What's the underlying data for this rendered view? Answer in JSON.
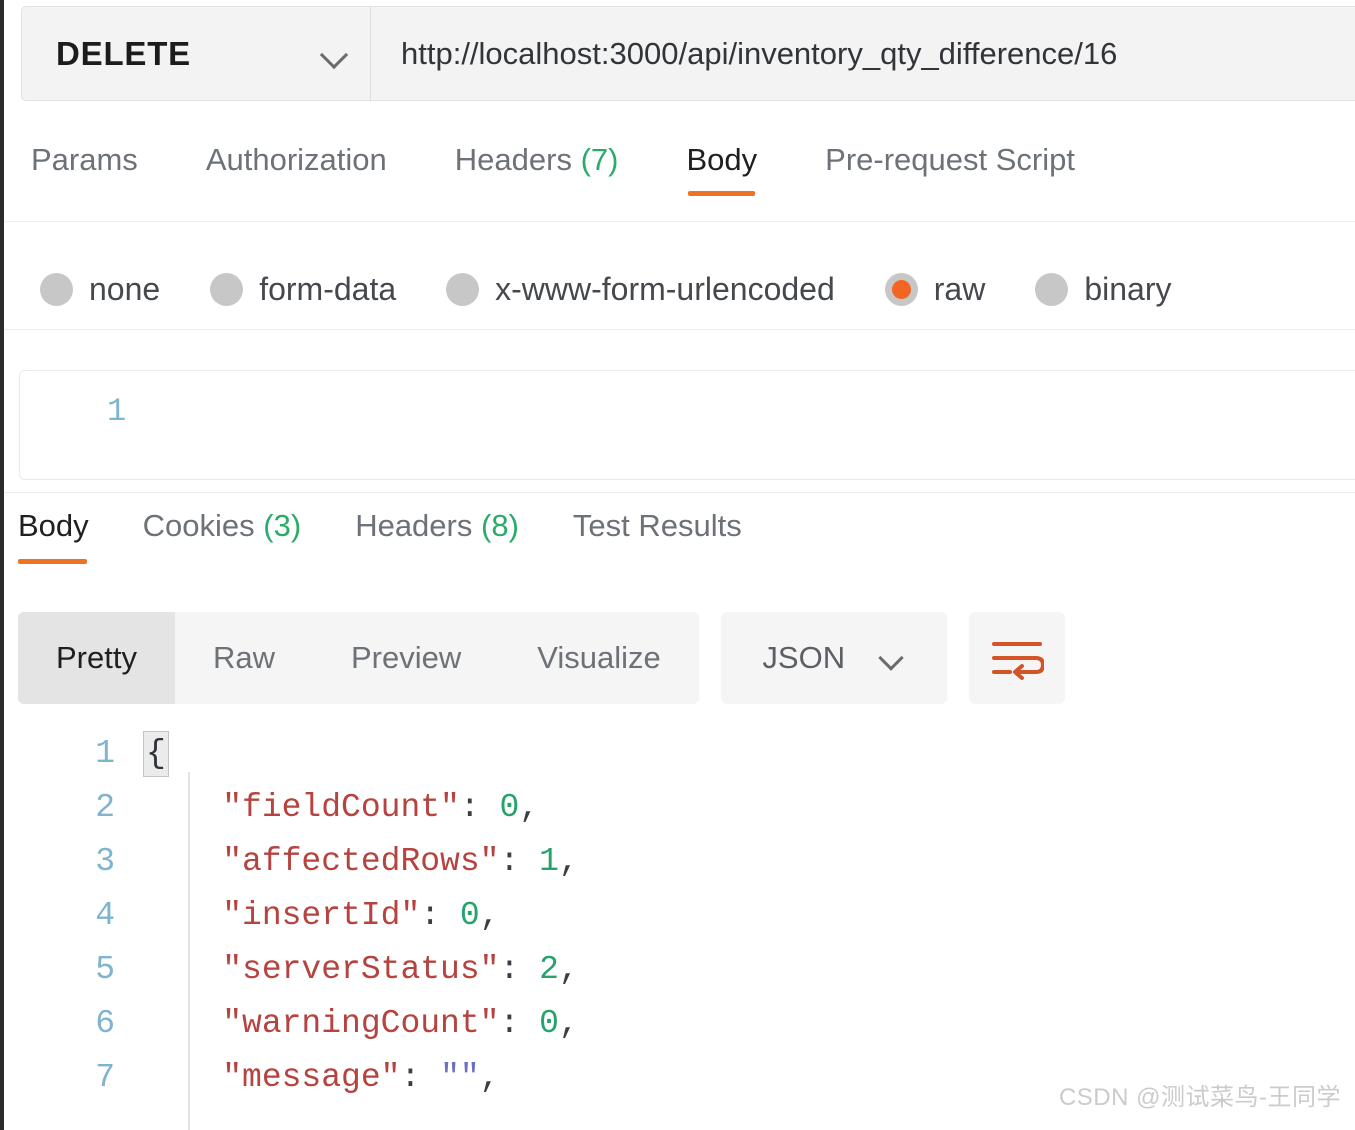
{
  "request_bar": {
    "method": "DELETE",
    "method_dropdown_icon": "chevron-down-icon",
    "url": "http://localhost:3000/api/inventory_qty_difference/16"
  },
  "request_tabs": [
    {
      "label": "Params",
      "count": "",
      "active": false
    },
    {
      "label": "Authorization",
      "count": "",
      "active": false
    },
    {
      "label": "Headers",
      "count": "(7)",
      "active": false
    },
    {
      "label": "Body",
      "count": "",
      "active": true
    },
    {
      "label": "Pre-request Script",
      "count": "",
      "active": false
    }
  ],
  "body_type_options": [
    {
      "label": "none",
      "selected": false
    },
    {
      "label": "form-data",
      "selected": false
    },
    {
      "label": "x-www-form-urlencoded",
      "selected": false
    },
    {
      "label": "raw",
      "selected": true
    },
    {
      "label": "binary",
      "selected": false
    }
  ],
  "request_editor": {
    "line_number": "1",
    "content": ""
  },
  "response_tabs": [
    {
      "label": "Body",
      "count": "",
      "active": true
    },
    {
      "label": "Cookies",
      "count": "(3)",
      "active": false
    },
    {
      "label": "Headers",
      "count": "(8)",
      "active": false
    },
    {
      "label": "Test Results",
      "count": "",
      "active": false
    }
  ],
  "format_toolbar": {
    "segments": [
      {
        "label": "Pretty",
        "active": true
      },
      {
        "label": "Raw",
        "active": false
      },
      {
        "label": "Preview",
        "active": false
      },
      {
        "label": "Visualize",
        "active": false
      }
    ],
    "language_select": "JSON",
    "language_dropdown_icon": "chevron-down-icon",
    "wrap_button_icon": "word-wrap-icon",
    "wrap_icon_color": "#d4542a"
  },
  "response_body": {
    "lines": [
      {
        "n": "1",
        "brace": "{",
        "key": "",
        "colon": "",
        "value": "",
        "value_type": "",
        "comma": ""
      },
      {
        "n": "2",
        "brace": "",
        "key": "\"fieldCount\"",
        "colon": ":",
        "value": "0",
        "value_type": "num",
        "comma": ","
      },
      {
        "n": "3",
        "brace": "",
        "key": "\"affectedRows\"",
        "colon": ":",
        "value": "1",
        "value_type": "num",
        "comma": ","
      },
      {
        "n": "4",
        "brace": "",
        "key": "\"insertId\"",
        "colon": ":",
        "value": "0",
        "value_type": "num",
        "comma": ","
      },
      {
        "n": "5",
        "brace": "",
        "key": "\"serverStatus\"",
        "colon": ":",
        "value": "2",
        "value_type": "num",
        "comma": ","
      },
      {
        "n": "6",
        "brace": "",
        "key": "\"warningCount\"",
        "colon": ":",
        "value": "0",
        "value_type": "num",
        "comma": ","
      },
      {
        "n": "7",
        "brace": "",
        "key": "\"message\"",
        "colon": ":",
        "value": "\"\"",
        "value_type": "str",
        "comma": ","
      }
    ]
  },
  "watermark": {
    "text": "CSDN @测试菜鸟-王同学"
  },
  "colors": {
    "accent": "#ef7324",
    "count_green": "#2aab6a",
    "json_key": "#b5433f",
    "json_number": "#26a36a",
    "json_string": "#6a6fc4",
    "line_number": "#7fb4cf"
  }
}
